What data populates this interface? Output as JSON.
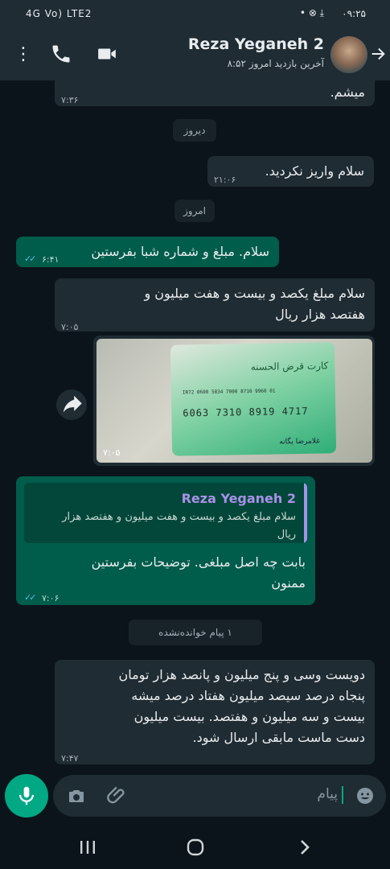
{
  "status_bar": {
    "time": "۰۹:۲۵",
    "left_signal": "4G Vo) LTE2"
  },
  "header": {
    "name": "Reza Yeganeh 2",
    "subtitle": "آخرین بازدید امروز ۸:۵۲"
  },
  "messages": [
    {
      "text": "میشم.",
      "time": "۷:۳۶"
    },
    {
      "chip": "دیروز"
    },
    {
      "text": "سلام واریز نکردید.",
      "time": "۲۱:۰۶"
    },
    {
      "chip": "امروز"
    },
    {
      "text": "سلام. مبلغ و شماره شبا بفرستین",
      "time": "۶:۴۱"
    },
    {
      "text": "سلام مبلغ یکصد و بیست و هفت میلیون و\nهفتصد هزار ریال",
      "time": "۷:۰۵"
    },
    {
      "photo_time": "۷:۰۵",
      "card_number": "6063  7310  8919  4717",
      "card_iban": "IR72 0600 5834 7000 8710 9960 01",
      "card_brand": "کارت قرض الحسنه",
      "card_holder": "غلامرضا یگانه"
    },
    {
      "reply_name": "Reza Yeganeh 2",
      "reply_text": "سلام مبلغ یکصد و بیست و هفت میلیون و هفتصد هزار\nریال",
      "text": "بابت چه اصل مبلغی.  توضیحات بفرستین\nممنون",
      "time": "۷:۰۶"
    },
    {
      "chip": "۱ پیام خوانده‌نشده"
    },
    {
      "text": "دویست وسی و پنج میلیون و پانصد هزار تومان\nپنجاه درصد سیصد میلیون هفتاد درصد میشه\nبیست و سه میلیون و هفتصد. بیست میلیون\nدست ماست مابقی ارسال شود.",
      "time": "۷:۴۷"
    }
  ],
  "input": {
    "placeholder": "پیام"
  },
  "colors": {
    "incoming": "#202c33",
    "outgoing": "#005c4b",
    "accent": "#00a884",
    "read_ticks": "#53bdeb"
  }
}
